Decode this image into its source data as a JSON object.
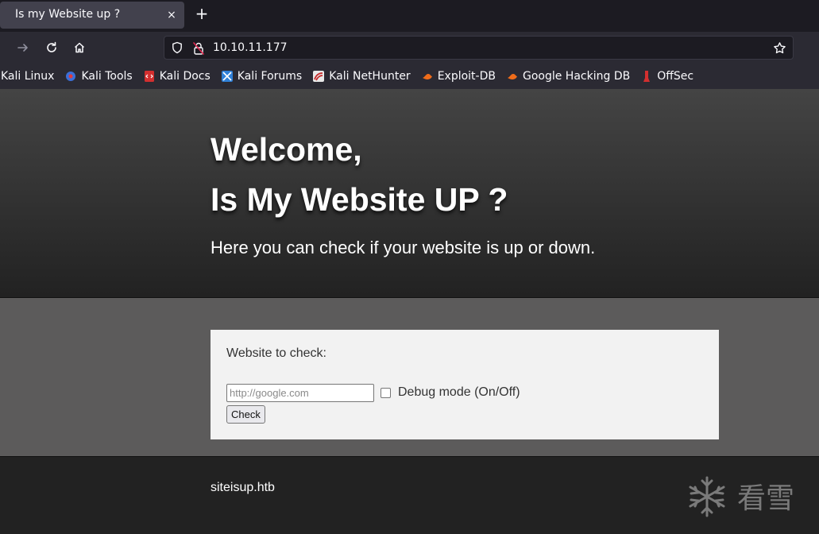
{
  "browser": {
    "tab_title": "Is my Website up ?",
    "tab_close_glyph": "×",
    "new_tab_glyph": "+",
    "url": "10.10.11.177",
    "bookmarks": [
      {
        "label": "Kali Linux",
        "icon": "kali-linux-icon"
      },
      {
        "label": "Kali Tools",
        "icon": "kali-tools-icon"
      },
      {
        "label": "Kali Docs",
        "icon": "kali-docs-icon"
      },
      {
        "label": "Kali Forums",
        "icon": "kali-forums-icon"
      },
      {
        "label": "Kali NetHunter",
        "icon": "kali-nethunter-icon"
      },
      {
        "label": "Exploit-DB",
        "icon": "exploit-db-icon"
      },
      {
        "label": "Google Hacking DB",
        "icon": "google-hacking-db-icon"
      },
      {
        "label": "OffSec",
        "icon": "offsec-icon"
      }
    ]
  },
  "hero": {
    "line1": "Welcome,",
    "line2": "Is My Website UP ?",
    "tagline": "Here you can check if your website is up or down."
  },
  "form": {
    "label": "Website to check:",
    "input_placeholder": "http://google.com",
    "input_value": "",
    "debug_label": "Debug mode (On/Off)",
    "debug_checked": false,
    "submit_label": "Check"
  },
  "footer": {
    "text": "siteisup.htb",
    "watermark_text": "看雪"
  },
  "colors": {
    "hero_gradient_top": "#444444",
    "hero_gradient_bottom": "#222222",
    "mid_background": "#5c5b5b",
    "card_background": "#f2f2f2",
    "footer_background": "#222222",
    "browser_toolbar": "#2b2a33"
  }
}
